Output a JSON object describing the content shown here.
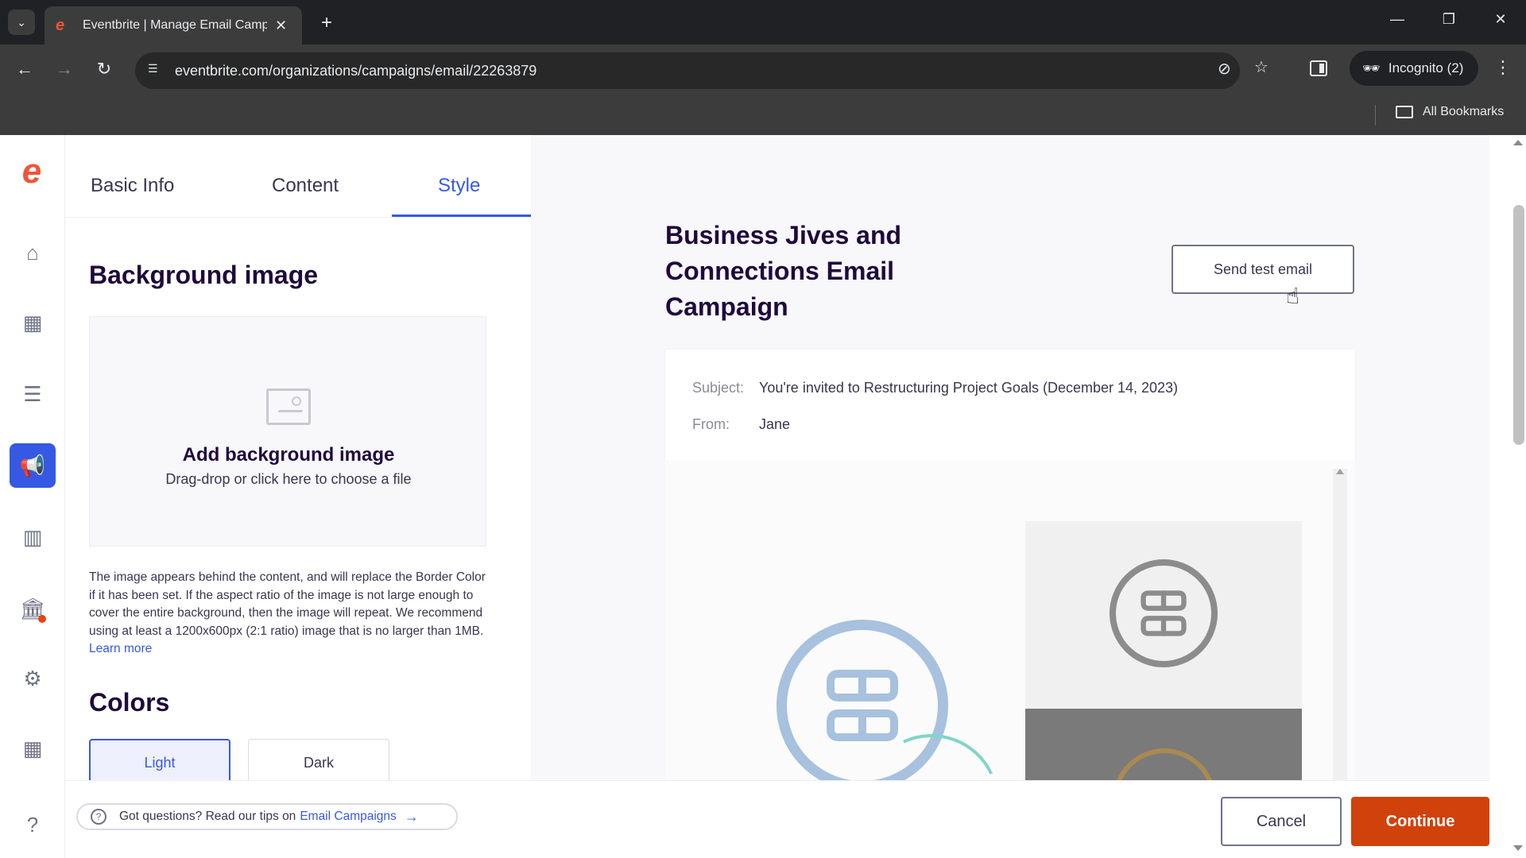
{
  "browser": {
    "tab_title": "Eventbrite | Manage Email Campaigns",
    "url": "eventbrite.com/organizations/campaigns/email/22263879",
    "incognito_label": "Incognito (2)",
    "bookmarks_label": "All Bookmarks",
    "icons": [
      "tab-list-icon",
      "eventbrite-favicon",
      "close-icon",
      "new-tab-icon",
      "minimize-icon",
      "restore-icon",
      "window-close-icon",
      "back-icon",
      "forward-icon",
      "reload-icon",
      "site-info-icon",
      "eye-off-icon",
      "star-icon",
      "side-panel-icon",
      "incognito-icon",
      "more-icon",
      "folder-icon"
    ]
  },
  "left_nav": {
    "items": [
      "home-icon",
      "calendar-icon",
      "orders-icon",
      "megaphone-icon",
      "reports-icon",
      "finance-icon",
      "settings-icon",
      "apps-icon",
      "help-icon"
    ],
    "active": "megaphone-icon",
    "brand_color": "#f05537",
    "active_color": "#3659e3"
  },
  "steps": {
    "tabs": [
      {
        "label": "Basic Info"
      },
      {
        "label": "Content"
      },
      {
        "label": "Style"
      }
    ],
    "active": "Style"
  },
  "background_image": {
    "title": "Background image",
    "dropzone_title": "Add background image",
    "dropzone_subtitle": "Drag-drop or click here to choose a file",
    "help_text": "The image appears behind the content, and will replace the Border Color if it has been set. If the aspect ratio of the image is not large enough to cover the entire background, then the image will repeat. We recommend using at least a 1200x600px (2:1 ratio) image that is no larger than 1MB.",
    "learn_more": "Learn more"
  },
  "colors": {
    "title": "Colors",
    "options": [
      "Light",
      "Dark"
    ],
    "selected": "Light"
  },
  "preview": {
    "campaign_title": "Business Jives and Connections Email Campaign",
    "send_test_label": "Send test email",
    "subject_label": "Subject:",
    "subject_value": "You're invited to Restructuring Project Goals (December 14, 2023)",
    "from_label": "From:",
    "from_value": "Jane"
  },
  "footer": {
    "tips_text": "Got questions? Read our tips on",
    "tips_link": "Email Campaigns",
    "cancel_label": "Cancel",
    "continue_label": "Continue",
    "continue_color": "#d1410c"
  }
}
